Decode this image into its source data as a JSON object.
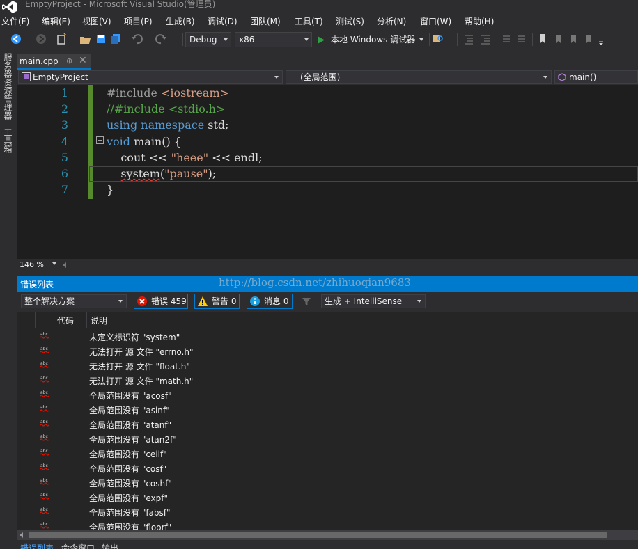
{
  "window": {
    "title": "EmptyProject - Microsoft Visual Studio(管理员)"
  },
  "menu": [
    "文件(F)",
    "编辑(E)",
    "视图(V)",
    "项目(P)",
    "生成(B)",
    "调试(D)",
    "团队(M)",
    "工具(T)",
    "测试(S)",
    "分析(N)",
    "窗口(W)",
    "帮助(H)"
  ],
  "toolbar": {
    "config": "Debug",
    "platform": "x86",
    "run_label": "本地 Windows 调试器"
  },
  "sidebar": {
    "tabs": [
      "服务器资源管理器",
      "工具箱"
    ]
  },
  "doc_tab": {
    "label": "main.cpp",
    "pin": "⊕",
    "close": "✕"
  },
  "navbar": {
    "project": "EmptyProject",
    "scope": "(全局范围)",
    "member": "main()"
  },
  "editor": {
    "line_numbers": [
      "1",
      "2",
      "3",
      "4",
      "5",
      "6",
      "7"
    ],
    "lines": [
      {
        "parts": [
          {
            "t": "#include ",
            "c": "pp"
          },
          {
            "t": "<iostream>",
            "c": "inc"
          }
        ]
      },
      {
        "parts": [
          {
            "t": "//#include <stdio.h>",
            "c": "cm"
          }
        ]
      },
      {
        "parts": [
          {
            "t": "using",
            "c": "kw"
          },
          {
            "t": " ",
            "c": ""
          },
          {
            "t": "namespace",
            "c": "kw"
          },
          {
            "t": " std;",
            "c": ""
          }
        ]
      },
      {
        "parts": [
          {
            "t": "void",
            "c": "kw"
          },
          {
            "t": " main() {",
            "c": ""
          }
        ]
      },
      {
        "parts": [
          {
            "t": "    cout << ",
            "c": ""
          },
          {
            "t": "\"heee\"",
            "c": "str"
          },
          {
            "t": " << endl;",
            "c": ""
          }
        ]
      },
      {
        "parts": [
          {
            "t": "    ",
            "c": ""
          },
          {
            "t": "system",
            "c": "squiggle"
          },
          {
            "t": "(",
            "c": ""
          },
          {
            "t": "\"pause\"",
            "c": "str"
          },
          {
            "t": ");",
            "c": ""
          }
        ]
      },
      {
        "parts": [
          {
            "t": "}",
            "c": ""
          }
        ]
      }
    ],
    "zoom": "146 %"
  },
  "error_list": {
    "title": "错误列表",
    "watermark": "http://blog.csdn.net/zhihuoqian9683",
    "scope": "整个解决方案",
    "errors_label": "错误 459",
    "warnings_label": "警告 0",
    "messages_label": "消息 0",
    "build_filter": "生成 + IntelliSense",
    "columns": {
      "code": "代码",
      "description": "说明"
    },
    "rows": [
      "未定义标识符 \"system\"",
      "无法打开 源 文件 \"errno.h\"",
      "无法打开 源 文件 \"float.h\"",
      "无法打开 源 文件 \"math.h\"",
      "全局范围没有 \"acosf\"",
      "全局范围没有 \"asinf\"",
      "全局范围没有 \"atanf\"",
      "全局范围没有 \"atan2f\"",
      "全局范围没有 \"ceilf\"",
      "全局范围没有 \"cosf\"",
      "全局范围没有 \"coshf\"",
      "全局范围没有 \"expf\"",
      "全局范围没有 \"fabsf\"",
      "全局范围没有 \"floorf\""
    ]
  },
  "bottom_tabs": [
    "错误列表",
    "命令窗口",
    "输出"
  ],
  "colors": {
    "accent": "#007acc",
    "error": "#e51400",
    "warning": "#ffcc00",
    "info": "#1ba1e2"
  }
}
